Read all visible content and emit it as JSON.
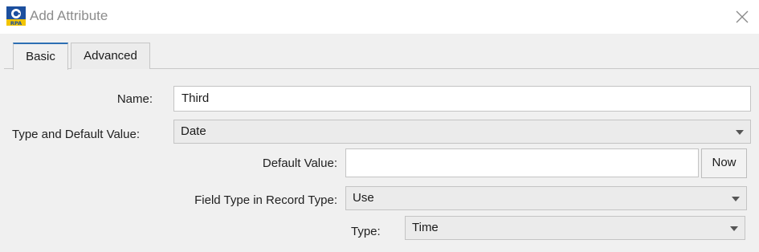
{
  "window": {
    "title": "Add Attribute",
    "icon": "erpa-logo-icon",
    "close_icon": "close-icon"
  },
  "tabs": [
    {
      "label": "Basic",
      "active": true
    },
    {
      "label": "Advanced",
      "active": false
    }
  ],
  "form": {
    "name_label": "Name:",
    "name_value": "Third",
    "type_label": "Type and Default Value:",
    "type_value": "Date",
    "default_label": "Default Value:",
    "default_value": "",
    "now_button": "Now",
    "field_type_label": "Field Type in Record Type:",
    "field_type_value": "Use",
    "sub_type_label": "Type:",
    "sub_type_value": "Time"
  },
  "colors": {
    "active_tab_accent": "#2d6fb3",
    "title_text": "#8c8c8c"
  }
}
